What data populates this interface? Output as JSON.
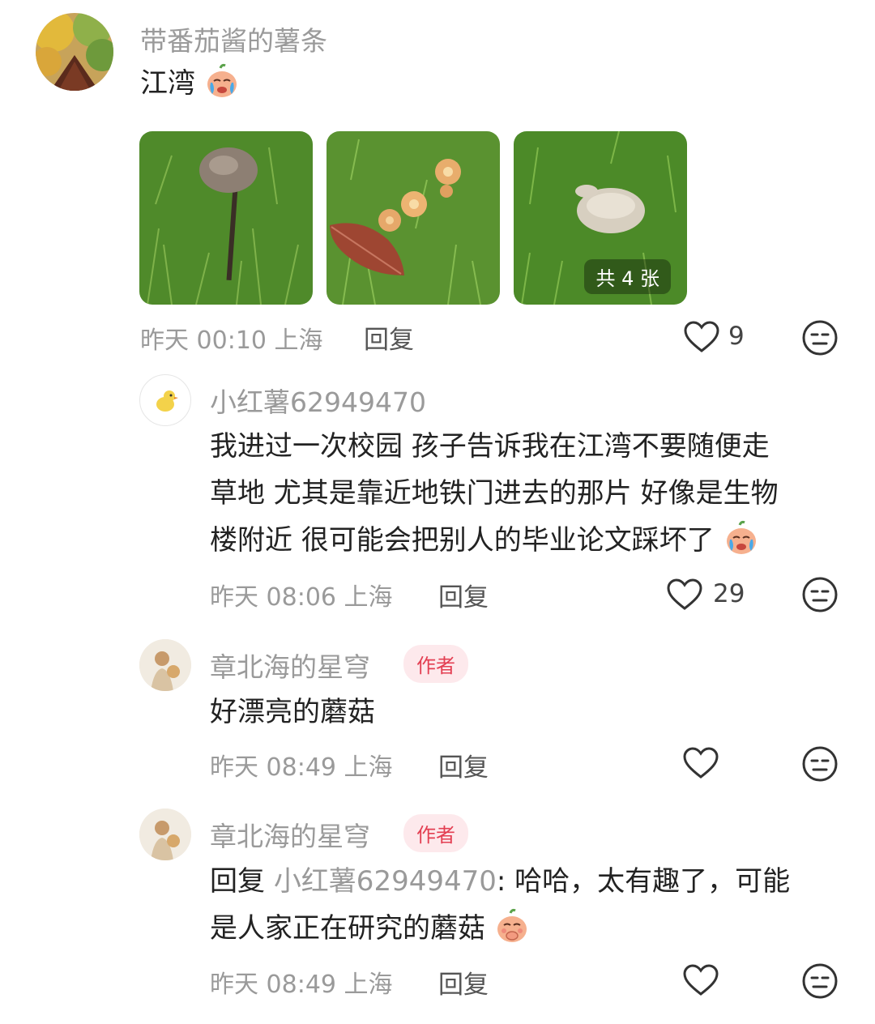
{
  "comment": {
    "username": "带番茄酱的薯条",
    "text": "江湾",
    "images_count_label": "共 4 张",
    "time": "昨天 00:10 上海",
    "reply_label": "回复",
    "likes": "9"
  },
  "replies": [
    {
      "username": "小红薯62949470",
      "lines": [
        "我进过一次校园 孩子告诉我在江湾不要随便走",
        "草地 尤其是靠近地铁门进去的那片 好像是生物",
        "楼附近 很可能会把别人的毕业论文踩坏了"
      ],
      "time": "昨天 08:06 上海",
      "reply_label": "回复",
      "likes": "29"
    },
    {
      "username": "章北海的星穹",
      "badge": "作者",
      "text": "好漂亮的蘑菇",
      "time": "昨天 08:49 上海",
      "reply_label": "回复"
    },
    {
      "username": "章北海的星穹",
      "badge": "作者",
      "reply_prefix": "回复",
      "reply_to": "小红薯62949470",
      "text_line1": ": 哈哈，太有趣了，可能",
      "text_line2": "是人家正在研究的蘑菇",
      "time": "昨天 08:49 上海",
      "reply_label": "回复"
    }
  ],
  "colors": {
    "muted": "#9a9a9a",
    "badge_bg": "#fde9ec",
    "badge_text": "#e33f52",
    "grass": "#4f8a2a"
  },
  "icons": [
    "heart-outline-icon",
    "neutral-face-icon",
    "crying-emoji-icon",
    "covering-mouth-emoji-icon"
  ]
}
